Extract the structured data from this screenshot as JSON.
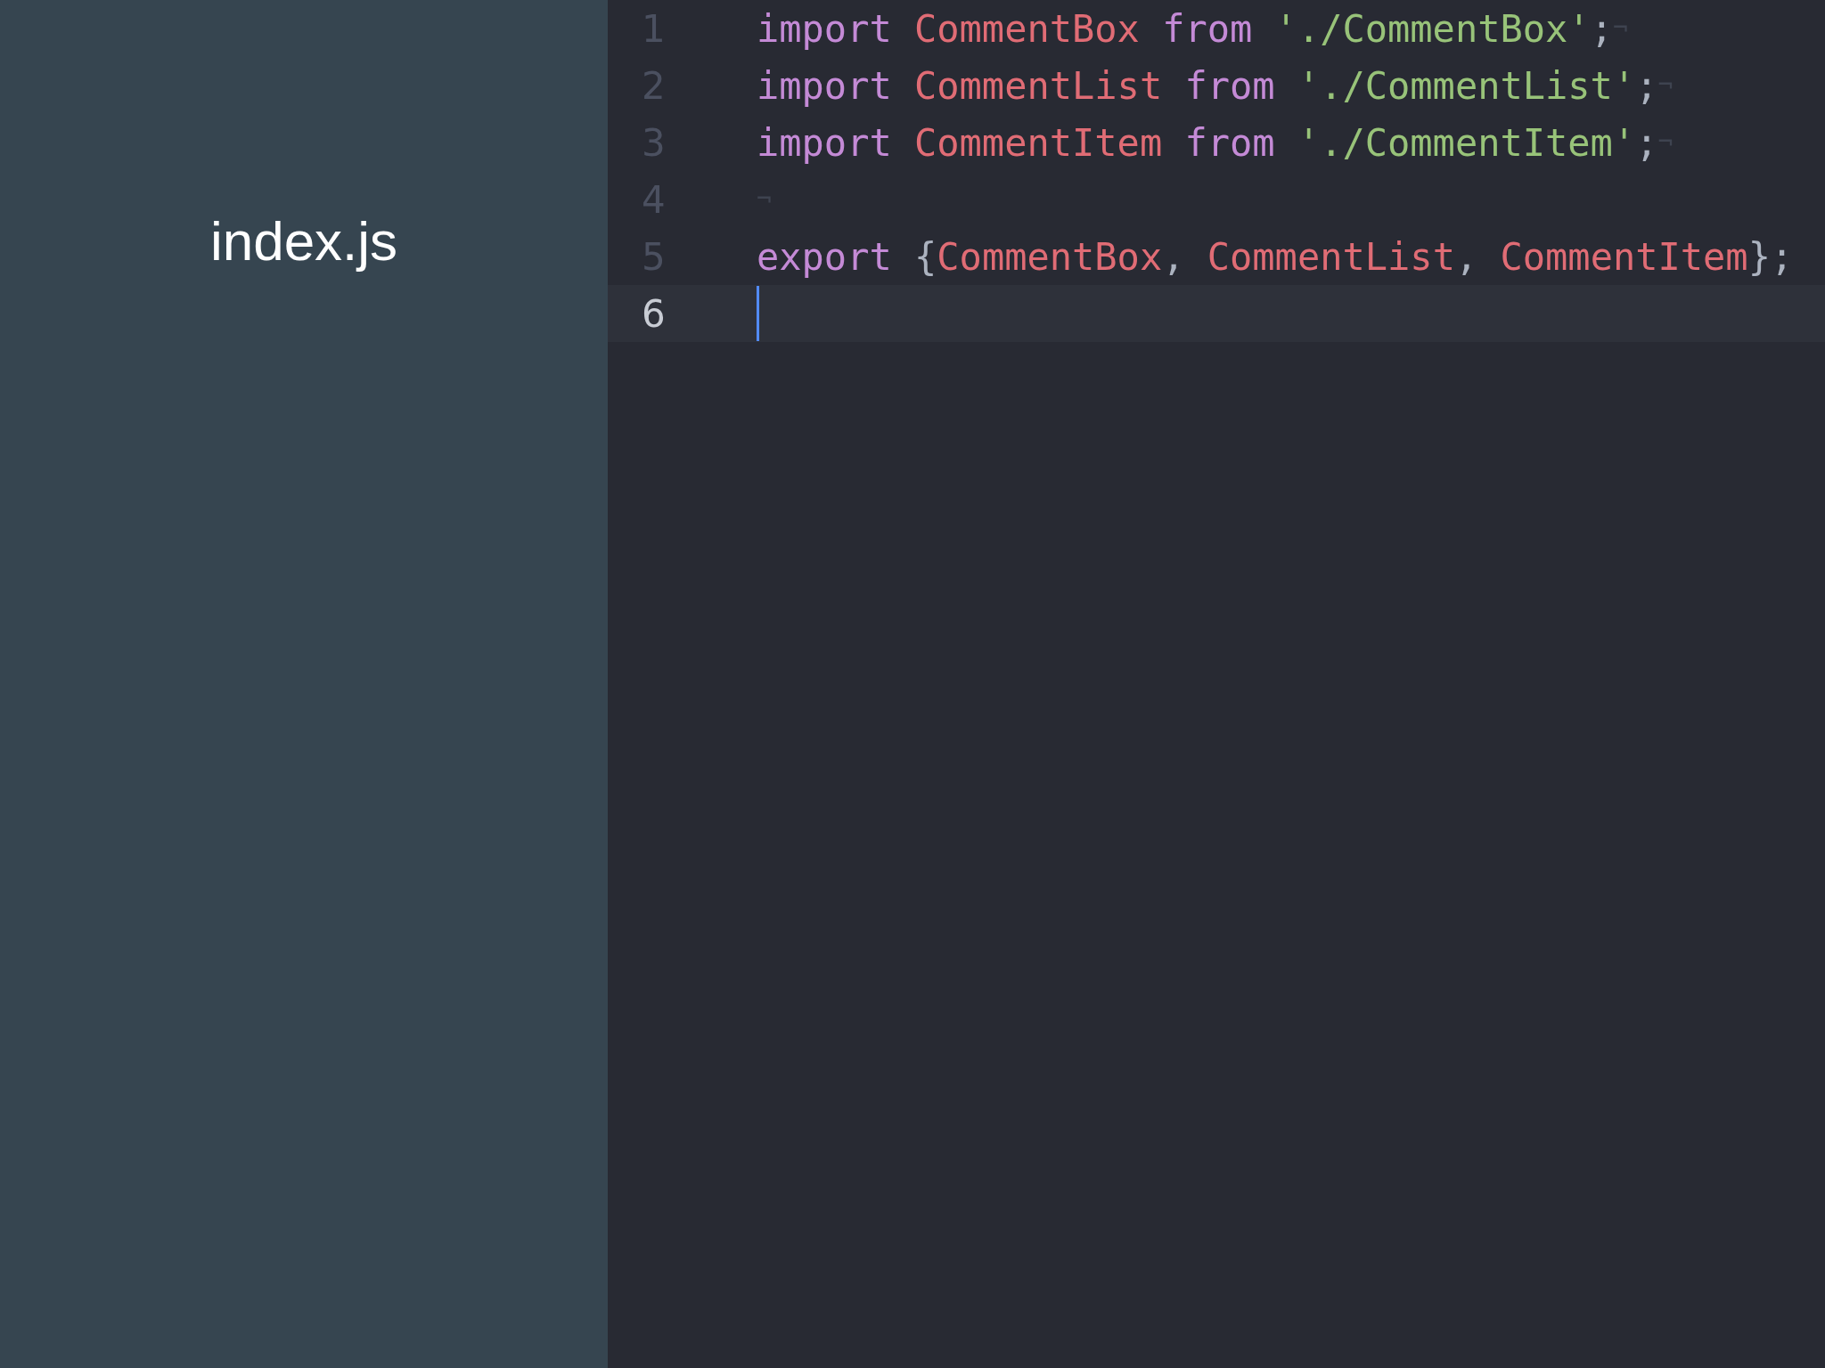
{
  "sidebar": {
    "title": "index.js"
  },
  "editor": {
    "lines": [
      {
        "number": "1",
        "current": false,
        "tokens": [
          {
            "kind": "keyword",
            "text": "import "
          },
          {
            "kind": "name",
            "text": "CommentBox "
          },
          {
            "kind": "keyword",
            "text": "from "
          },
          {
            "kind": "string",
            "text": "'./CommentBox'"
          },
          {
            "kind": "punct",
            "text": ";"
          },
          {
            "kind": "eol",
            "text": "¬"
          }
        ]
      },
      {
        "number": "2",
        "current": false,
        "tokens": [
          {
            "kind": "keyword",
            "text": "import "
          },
          {
            "kind": "name",
            "text": "CommentList "
          },
          {
            "kind": "keyword",
            "text": "from "
          },
          {
            "kind": "string",
            "text": "'./CommentList'"
          },
          {
            "kind": "punct",
            "text": ";"
          },
          {
            "kind": "eol",
            "text": "¬"
          }
        ]
      },
      {
        "number": "3",
        "current": false,
        "tokens": [
          {
            "kind": "keyword",
            "text": "import "
          },
          {
            "kind": "name",
            "text": "CommentItem "
          },
          {
            "kind": "keyword",
            "text": "from "
          },
          {
            "kind": "string",
            "text": "'./CommentItem'"
          },
          {
            "kind": "punct",
            "text": ";"
          },
          {
            "kind": "eol",
            "text": "¬"
          }
        ]
      },
      {
        "number": "4",
        "current": false,
        "tokens": [
          {
            "kind": "eol",
            "text": "¬"
          }
        ]
      },
      {
        "number": "5",
        "current": false,
        "tokens": [
          {
            "kind": "keyword",
            "text": "export "
          },
          {
            "kind": "punct",
            "text": "{"
          },
          {
            "kind": "name",
            "text": "CommentBox"
          },
          {
            "kind": "punct",
            "text": ", "
          },
          {
            "kind": "name",
            "text": "CommentList"
          },
          {
            "kind": "punct",
            "text": ", "
          },
          {
            "kind": "name",
            "text": "CommentItem"
          },
          {
            "kind": "punct",
            "text": "};"
          }
        ]
      },
      {
        "number": "6",
        "current": true
      }
    ]
  }
}
